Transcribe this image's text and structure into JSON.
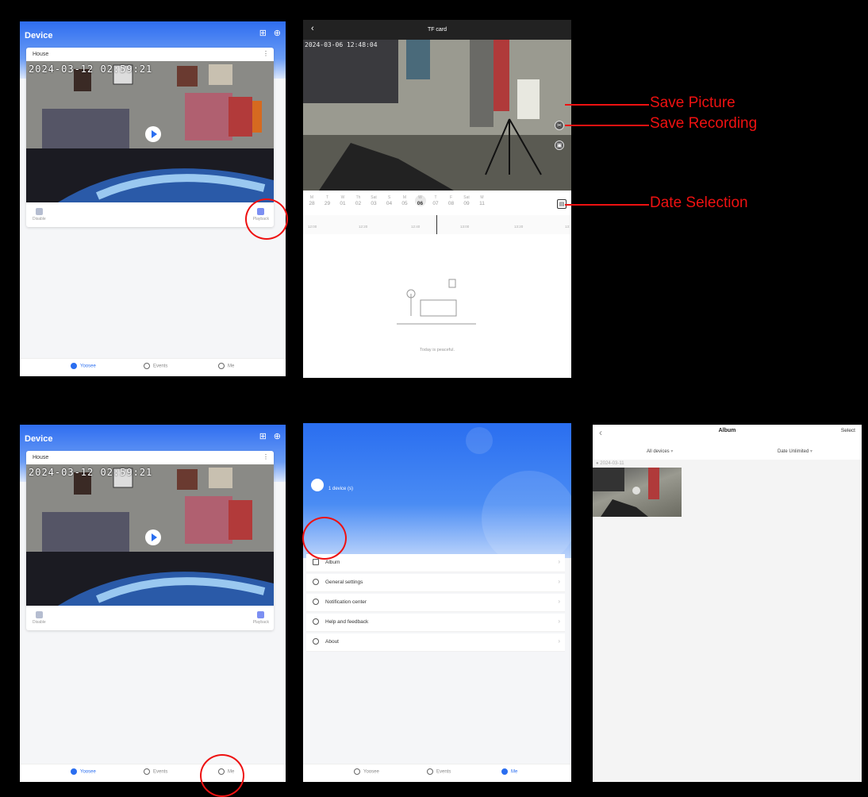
{
  "device_screen": {
    "title": "Device",
    "card_name": "House",
    "timestamp": "2024-03-12 02:59:21",
    "left_button": "Disable",
    "playback_label": "Playback",
    "tabs": [
      "Yoosee",
      "Events",
      "Me"
    ]
  },
  "tf_screen": {
    "title": "TF card",
    "timestamp": "2024-03-06 12:48:04",
    "dates": [
      {
        "day": "M",
        "num": "28"
      },
      {
        "day": "T",
        "num": "29"
      },
      {
        "day": "W",
        "num": "01"
      },
      {
        "day": "Th",
        "num": "02"
      },
      {
        "day": "Sat",
        "num": "03"
      },
      {
        "day": "S",
        "num": "04"
      },
      {
        "day": "M",
        "num": "05"
      },
      {
        "day": "W",
        "num": "06"
      },
      {
        "day": "T",
        "num": "07"
      },
      {
        "day": "F",
        "num": "08"
      },
      {
        "day": "Sat",
        "num": "09"
      },
      {
        "day": "M",
        "num": "11"
      }
    ],
    "selected_date": "06",
    "times": [
      "12:00",
      "12:20",
      "12:40",
      "13:00",
      "13:20",
      "13:"
    ],
    "empty_text": "Today is peaceful."
  },
  "annotations": {
    "save_picture": "Save Picture",
    "save_recording": "Save Recording",
    "date_selection": "Date Selection",
    "color": "#e11111"
  },
  "me_screen": {
    "device_count": "1 device (s)",
    "menu": [
      "Album",
      "General settings",
      "Notification center",
      "Help and feedback",
      "About"
    ],
    "tabs": [
      "Yoosee",
      "Events",
      "Me"
    ]
  },
  "album_screen": {
    "title": "Album",
    "select": "Select",
    "filter_devices": "All devices",
    "filter_date": "Date Unlimited",
    "date": "2024-03-11"
  },
  "colors": {
    "accent": "#2a6ef0",
    "annotation": "#e11111"
  }
}
